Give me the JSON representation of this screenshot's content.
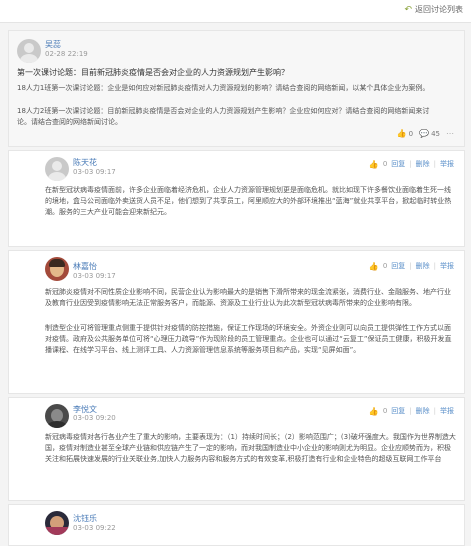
{
  "header": {
    "back_label": "返回讨论列表"
  },
  "post": {
    "author": "吴蕊",
    "time": "02-28 22:19",
    "title": "第一次课讨论题：目前新冠肺炎疫情是否会对企业的人力资源规划产生影响？",
    "body": [
      "18人力1班第一次课讨论题：企业是如何应对新冠肺炎疫情对人力资源规划的影响？请结合查阅的网络新闻，以某个具体企业为案例。",
      "18人力2班第一次课讨论题：目前新冠肺炎疫情是否会对企业的人力资源规划产生影响？企业应如何应对？请结合查阅的网络新闻来讨论。请结合查阅的网络新闻讨论。"
    ],
    "stats": {
      "likes": "0",
      "replies": "45"
    }
  },
  "replies": [
    {
      "author": "陈天花",
      "time": "03-03 09:17",
      "body": [
        "在新型冠状病毒疫情面前，许多企业面临着经济危机，企业人力资源管理规划更是面临危机。就比如现下许多餐饮业面临着生死一线的境地，盒马公司面临外卖送货人员不足，他们想到了共享员工，阿里顺应大的外部环境推出“蓝海”就业共享平台，掀起临时转业热潮。服务的三大产业可能会迎来新纪元。"
      ],
      "likes": "0",
      "actions": {
        "reply": "回复",
        "delete": "删除",
        "report": "举报"
      }
    },
    {
      "author": "林嘉怡",
      "time": "03-03 09:17",
      "body": [
        "新冠肺炎疫情对不同性质企业影响不同，民营企业认为影响最大的是销售下滑所带来的现金流紧张，消费行业、金融服务、地产行业及教育行业因受到疫情影响无法正常服务客户，而能源、资源及工业行业认为此次新型冠状病毒所带来的企业影响有限。",
        "制造型企业可将管理重点侧重于提供针对疫情的防控措施，保证工作现场的环境安全。外资企业则可以向员工提供弹性工作方式以面对疫情。政府及公共服务单位可将“心理压力疏导”作为现阶段的员工管理重点。企业也可以通过“云复工”保证员工健康，积极开发直播课程、在线学习平台、线上测评工具、人力资源管理信息系统等服务项目和产品，实现“见屏如面”。"
      ],
      "likes": "0",
      "actions": {
        "reply": "回复",
        "delete": "删除",
        "report": "举报"
      }
    },
    {
      "author": "李悦文",
      "time": "03-03 09:20",
      "body": [
        "新冠病毒疫情对各行各业产生了重大的影响，主要表现为：（1）持续时间长；（2）影响范围广；(3)破坏强度大。我国作为世界制造大国，疫情对制造业甚至全球产业链和供应链产生了一定的影响，而对我国制造业中小企业的影响则尤为明显。企业应顺势而为，积极关注和拓展快速发展的行业关联业务,加快人力服务内容和服务方式的有效变革,积极打造有行业和企业特色的超级互联网工作平台"
      ],
      "likes": "0",
      "actions": {
        "reply": "回复",
        "delete": "删除",
        "report": "举报"
      }
    },
    {
      "author": "沈钰乐",
      "time": "03-03 09:22",
      "body": [],
      "likes": "",
      "actions": {
        "reply": "",
        "delete": "",
        "report": ""
      }
    }
  ]
}
